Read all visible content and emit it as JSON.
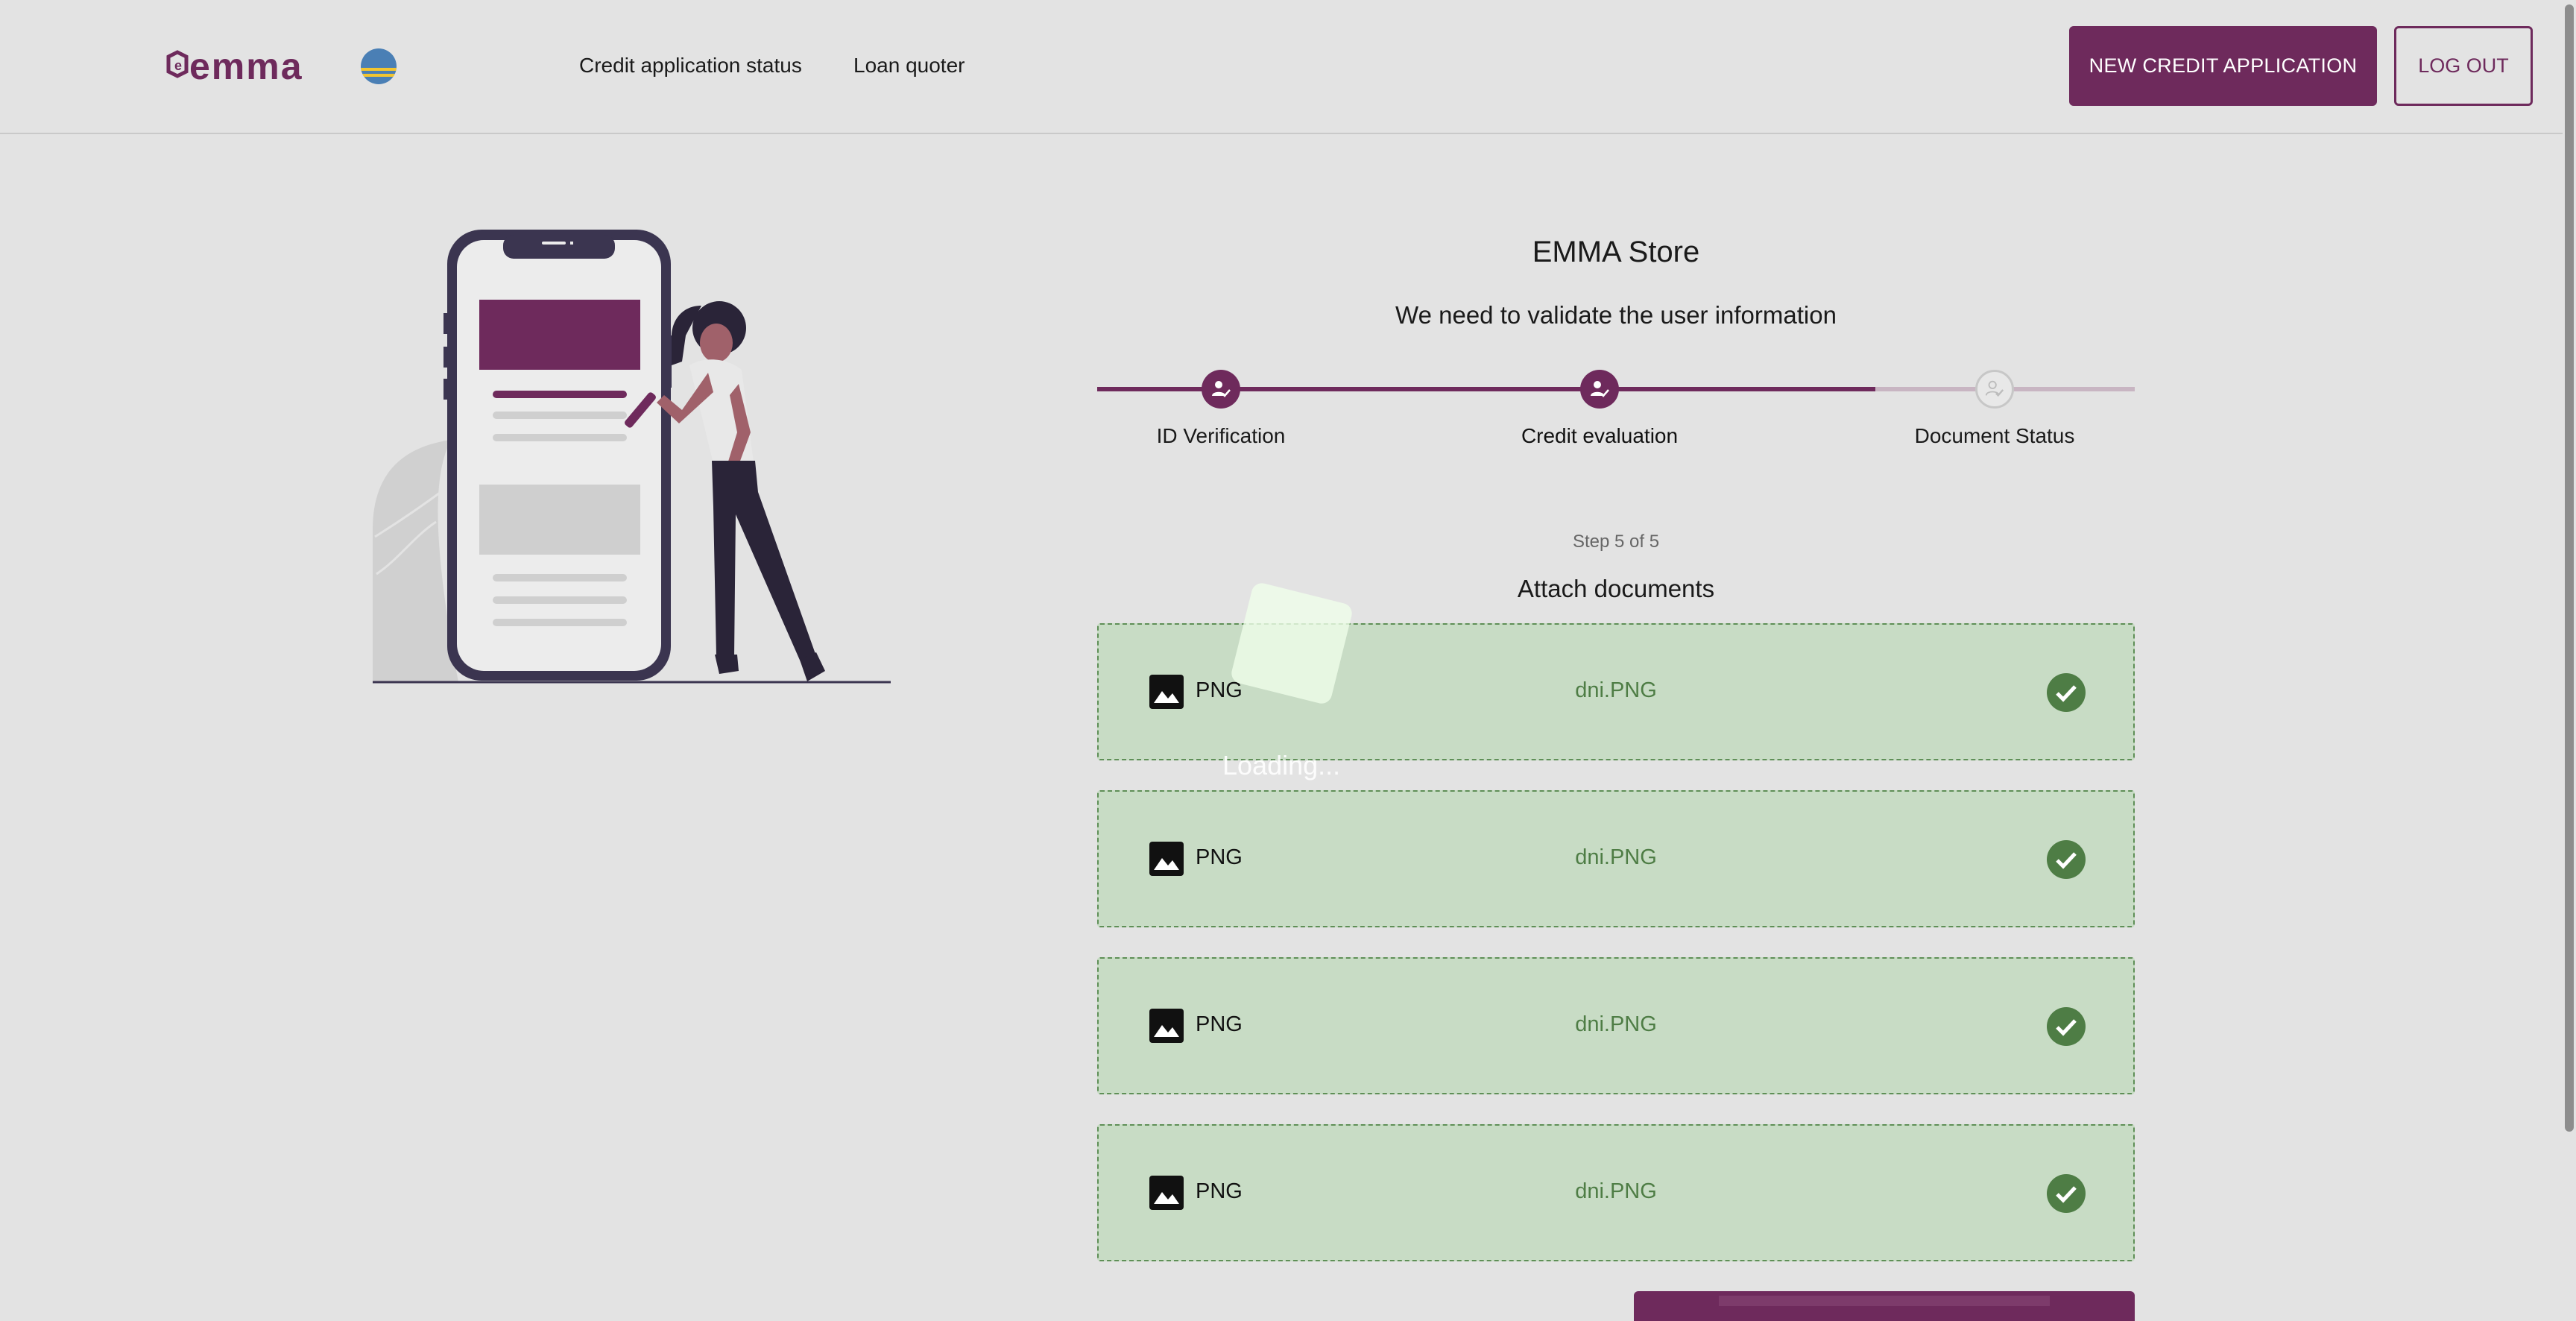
{
  "header": {
    "logo_text": "emma",
    "nav": [
      "Credit application status",
      "Loan quoter"
    ],
    "new_application_label": "NEW CREDIT APPLICATION",
    "logout_label": "LOG OUT"
  },
  "main": {
    "store_name": "EMMA Store",
    "subtitle": "We need to validate the user information",
    "steps": [
      {
        "label": "ID Verification",
        "status": "completed"
      },
      {
        "label": "Credit evaluation",
        "status": "current"
      },
      {
        "label": "Document Status",
        "status": "pending"
      }
    ],
    "step_counter": "Step 5 of 5",
    "attach_title": "Attach documents",
    "documents": [
      {
        "type": "PNG",
        "name": "dni.PNG",
        "status": "uploaded"
      },
      {
        "type": "PNG",
        "name": "dni.PNG",
        "status": "uploaded"
      },
      {
        "type": "PNG",
        "name": "dni.PNG",
        "status": "uploaded"
      },
      {
        "type": "PNG",
        "name": "dni.PNG",
        "status": "uploaded"
      }
    ],
    "loading_text": "Loading..."
  },
  "colors": {
    "brand": "#6e2a5c",
    "success_bg": "#c8dcc5",
    "success_border": "#5f8f57",
    "success_check": "#4e7d45"
  }
}
